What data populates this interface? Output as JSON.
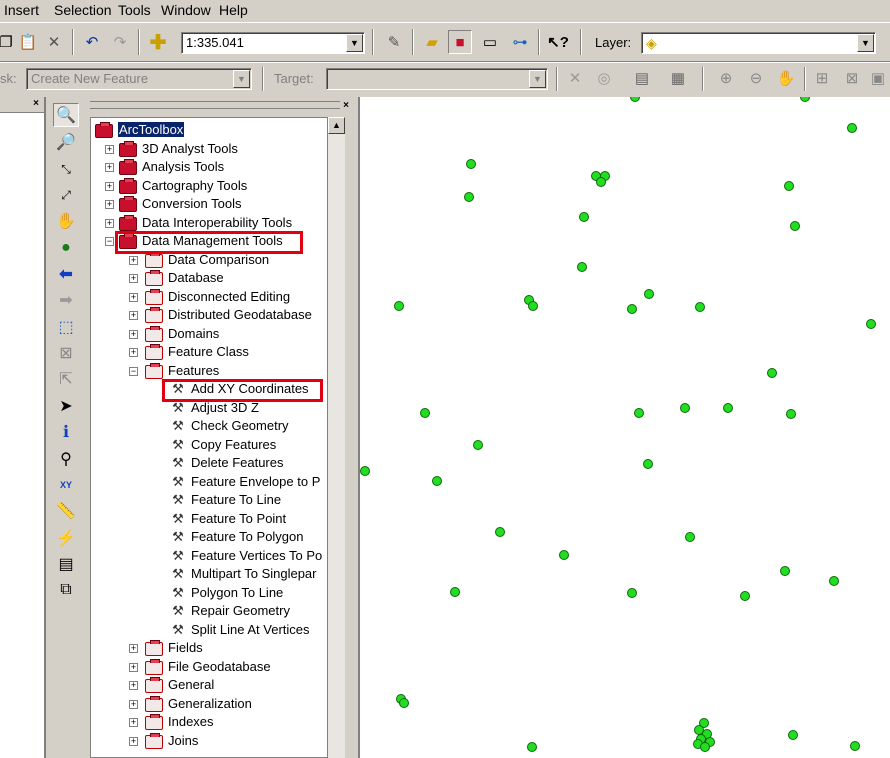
{
  "menu": [
    "Insert",
    "Selection",
    "Tools",
    "Window",
    "Help"
  ],
  "toolbar": {
    "scale_value": "1:335.041",
    "layer_label": "Layer:",
    "task_label": "sk:",
    "task_value": "Create New Feature",
    "target_label": "Target:"
  },
  "toolbox": {
    "root": "ArcToolbox",
    "top_level": [
      {
        "label": "3D Analyst Tools"
      },
      {
        "label": "Analysis Tools"
      },
      {
        "label": "Cartography Tools"
      },
      {
        "label": "Conversion Tools"
      },
      {
        "label": "Data Interoperability Tools"
      },
      {
        "label": "Data Management Tools"
      }
    ],
    "data_management_children": [
      {
        "label": "Data Comparison"
      },
      {
        "label": "Database"
      },
      {
        "label": "Disconnected Editing"
      },
      {
        "label": "Distributed Geodatabase"
      },
      {
        "label": "Domains"
      },
      {
        "label": "Feature Class"
      },
      {
        "label": "Features"
      }
    ],
    "features_tools": [
      {
        "label": "Add XY Coordinates"
      },
      {
        "label": "Adjust 3D Z"
      },
      {
        "label": "Check Geometry"
      },
      {
        "label": "Copy Features"
      },
      {
        "label": "Delete Features"
      },
      {
        "label": "Feature Envelope to P"
      },
      {
        "label": "Feature To Line"
      },
      {
        "label": "Feature To Point"
      },
      {
        "label": "Feature To Polygon"
      },
      {
        "label": "Feature Vertices To Po"
      },
      {
        "label": "Multipart To Singlepar"
      },
      {
        "label": "Polygon To Line"
      },
      {
        "label": "Repair Geometry"
      },
      {
        "label": "Split Line At Vertices"
      }
    ],
    "more_children": [
      {
        "label": "Fields"
      },
      {
        "label": "File Geodatabase"
      },
      {
        "label": "General"
      },
      {
        "label": "Generalization"
      },
      {
        "label": "Indexes"
      },
      {
        "label": "Joins"
      }
    ]
  },
  "colors": {
    "highlight": "#e00010",
    "point": "#22dd22",
    "selection": "#0a246a"
  }
}
